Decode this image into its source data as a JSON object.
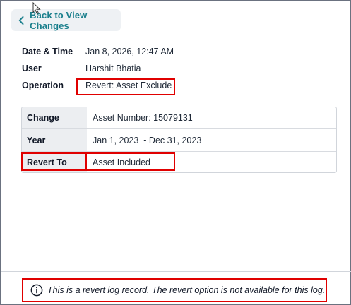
{
  "back_button": {
    "label": "Back to View Changes"
  },
  "details": {
    "rows": [
      {
        "key": "Date & Time",
        "value": "Jan 8, 2026, 12:47 AM"
      },
      {
        "key": "User",
        "value": "Harshit Bhatia"
      },
      {
        "key": "Operation",
        "value": "Revert: Asset Exclude"
      }
    ]
  },
  "change_table": {
    "rows": [
      {
        "key": "Change",
        "value": "Asset Number: 15079131"
      },
      {
        "key": "Year",
        "value": "Jan 1, 2023  - Dec 31, 2023"
      },
      {
        "key": "Revert To",
        "value": "Asset Included"
      }
    ]
  },
  "notice": {
    "text": "This is a revert log record. The revert option is not available for this log."
  },
  "colors": {
    "accent": "#1a7f8c",
    "highlight": "#e00000",
    "key_bg": "#eceef1",
    "button_bg": "#eef1f4"
  },
  "icons": {
    "back": "chevron-left-icon",
    "info": "info-circle-icon",
    "cursor": "mouse-pointer-icon"
  }
}
